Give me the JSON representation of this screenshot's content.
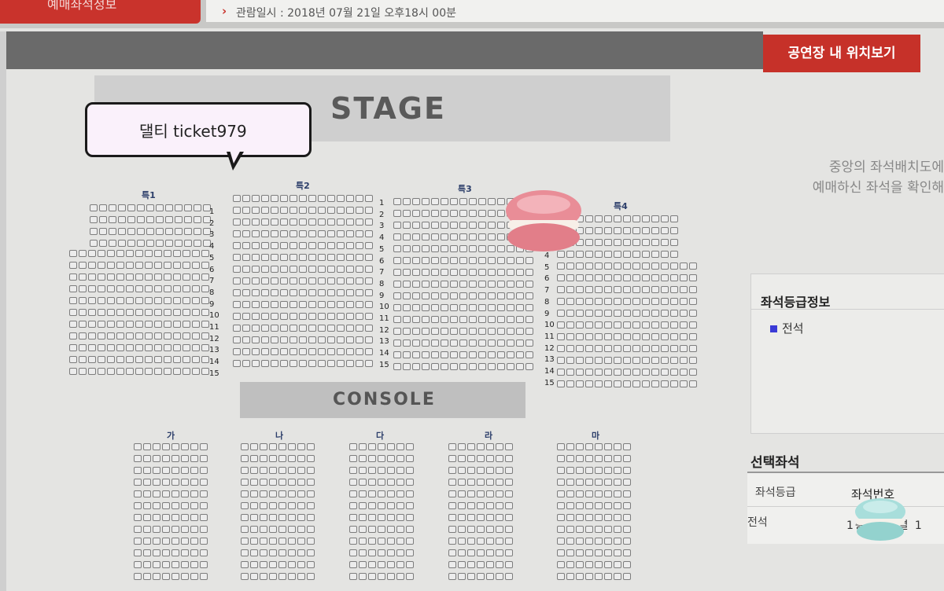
{
  "header": {
    "tab_label": "예매좌석정보",
    "viewing_datetime": "관람일시 : 2018년 07월 21일 오후18시 00분",
    "location_button": "공연장 내 위치보기"
  },
  "stage": {
    "label": "STAGE"
  },
  "console": {
    "label": "CONSOLE"
  },
  "sticker": {
    "text": "댈티 ticket979"
  },
  "side_note": {
    "line1": "중앙의 좌석배치도에",
    "line2": "예매하신 좌석을 확인해"
  },
  "sections_top": [
    "특1",
    "특2",
    "특3",
    "특4"
  ],
  "sections_bottom": [
    "가",
    "나",
    "다",
    "라",
    "마"
  ],
  "row_numbers": [
    "1",
    "2",
    "3",
    "4",
    "5",
    "6",
    "7",
    "8",
    "9",
    "10",
    "11",
    "12",
    "13",
    "14",
    "15"
  ],
  "grade_panel": {
    "title": "좌석등급정보",
    "legend": "전석",
    "legend_color": "#3a3ad6"
  },
  "selected": {
    "title": "선택좌석",
    "col_grade": "좌석등급",
    "col_seat": "좌석번호",
    "grade_value": "전석",
    "seat_value": "1층 … 2열 1"
  },
  "colors": {
    "accent": "#c63129",
    "stage": "#cfcfcf",
    "console": "#bfbfbf"
  },
  "icons": [
    "pink-macaron-sticker",
    "mint-macaron-sticker"
  ]
}
